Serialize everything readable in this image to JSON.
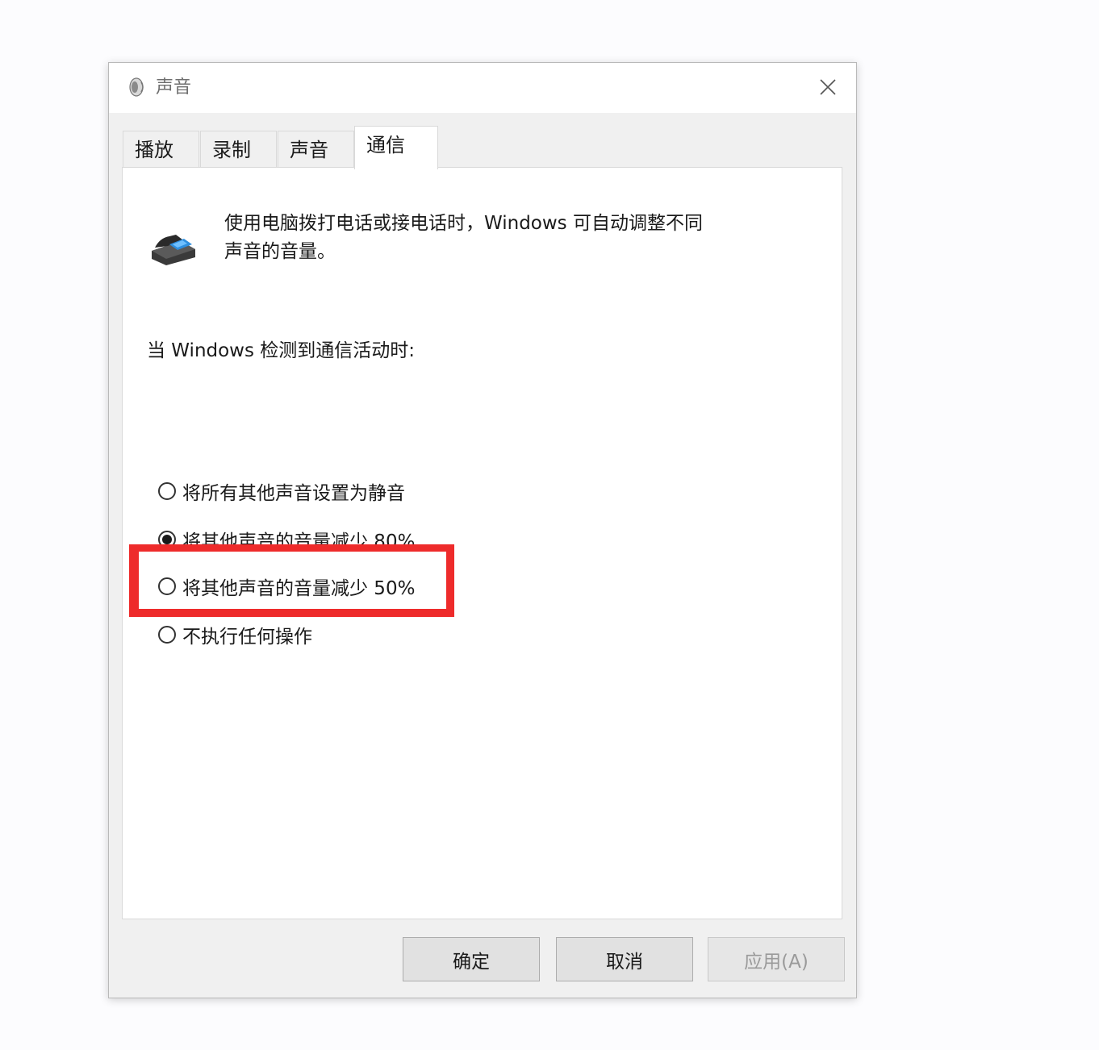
{
  "window": {
    "title": "声音"
  },
  "tabs": [
    {
      "label": "播放",
      "active": false
    },
    {
      "label": "录制",
      "active": false
    },
    {
      "label": "声音",
      "active": false
    },
    {
      "label": "通信",
      "active": true
    }
  ],
  "communications": {
    "description_line1": "使用电脑拨打电话或接电话时，Windows 可自动调整不同",
    "description_line2": "声音的音量。",
    "detect_label": "当 Windows 检测到通信活动时:",
    "options": [
      {
        "label": "将所有其他声音设置为静音",
        "selected": false
      },
      {
        "label": "将其他声音的音量减少 80%",
        "selected": true
      },
      {
        "label": "将其他声音的音量减少 50%",
        "selected": false
      },
      {
        "label": "不执行任何操作",
        "selected": false
      }
    ]
  },
  "buttons": {
    "ok": "确定",
    "cancel": "取消",
    "apply": "应用(A)",
    "apply_disabled": true
  },
  "colors": {
    "highlight": "#ee2b2b"
  }
}
